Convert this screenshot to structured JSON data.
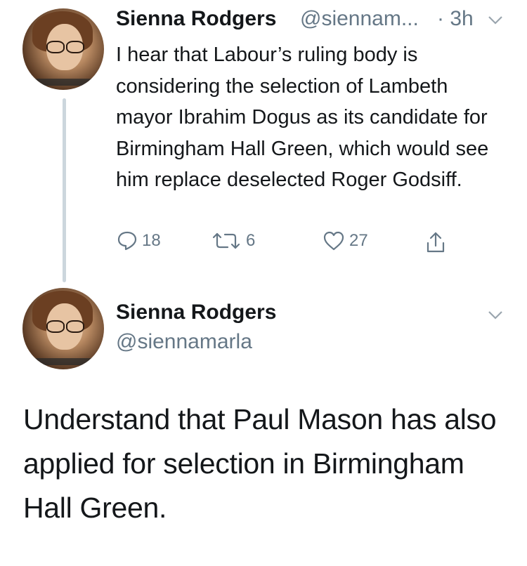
{
  "tweet1": {
    "name": "Sienna Rodgers",
    "handle": "@siennam...",
    "time": "· 3h",
    "text": "I hear that Labour’s ruling body is considering the selection of Lambeth mayor Ibrahim Dogus as its candidate for Birmingham Hall Green, which would see him replace deselected Roger Godsiff.",
    "actions": {
      "reply_count": "18",
      "retweet_count": "6",
      "like_count": "27"
    }
  },
  "tweet2": {
    "name": "Sienna Rodgers",
    "handle": "@siennamarla",
    "text": "Understand that Paul Mason has also applied for selection in Birmingham Hall Green."
  },
  "colors": {
    "text": "#14171a",
    "secondary": "#657786",
    "thread_line": "#ccd6dd",
    "background": "#ffffff"
  },
  "icons": [
    "reply-icon",
    "retweet-icon",
    "like-icon",
    "share-icon",
    "chevron-down-icon"
  ]
}
